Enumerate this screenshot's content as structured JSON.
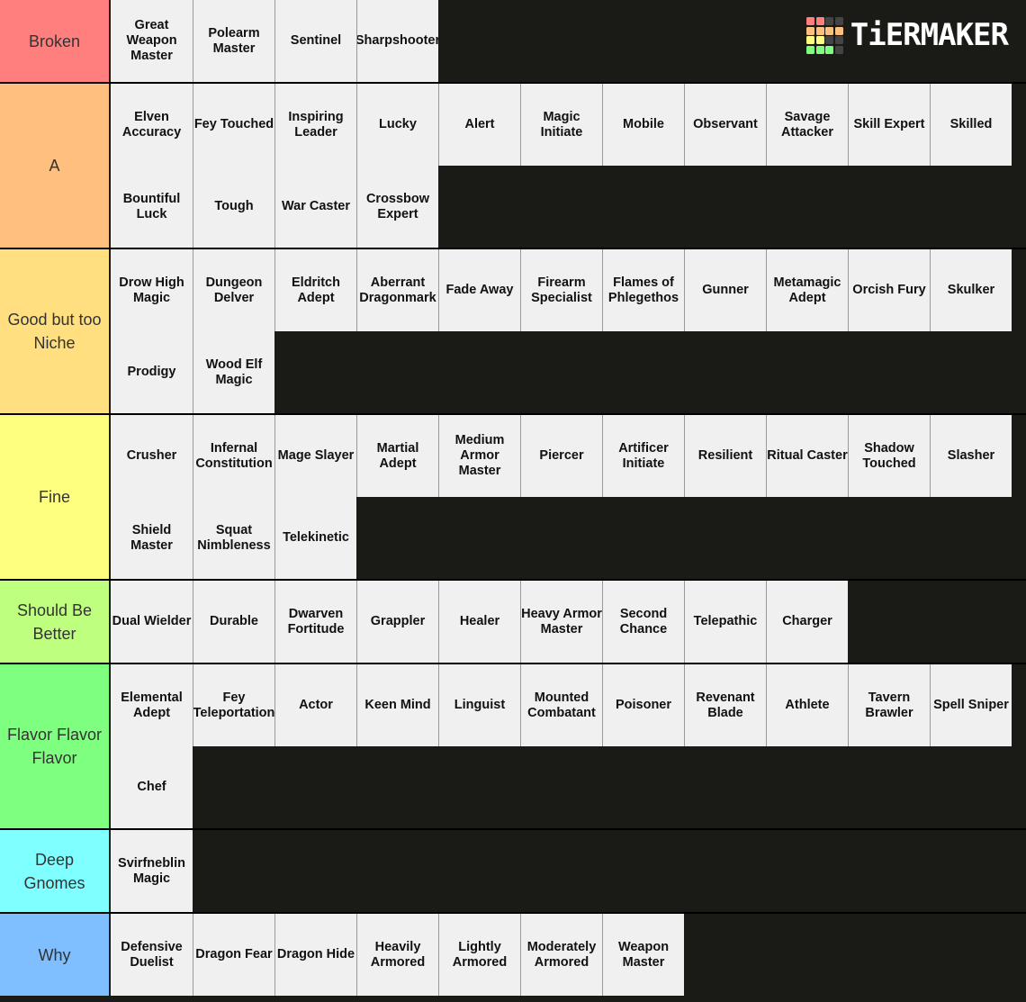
{
  "logo": {
    "text": "TiERMAKER",
    "grid_colors": [
      "#ff7f7f",
      "#ff7f7f",
      "#444444",
      "#444444",
      "#ffbf7f",
      "#ffbf7f",
      "#ffbf7f",
      "#ffbf7f",
      "#ffff7f",
      "#ffff7f",
      "#444444",
      "#444444",
      "#7fff7f",
      "#7fff7f",
      "#7fff7f",
      "#444444"
    ]
  },
  "tiers": [
    {
      "label": "Broken",
      "color": "#ff7f7f",
      "rows": [
        [
          "Great Weapon Master",
          "Polearm Master",
          "Sentinel",
          "Sharpshooter"
        ]
      ]
    },
    {
      "label": "A",
      "color": "#ffbf7f",
      "rows": [
        [
          "Elven Accuracy",
          "Fey Touched",
          "Inspiring Leader",
          "Lucky",
          "Alert",
          "Magic Initiate",
          "Mobile",
          "Observant",
          "Savage Attacker",
          "Skill Expert",
          "Skilled"
        ],
        [
          "Bountiful Luck",
          "Tough",
          "War Caster",
          "Crossbow Expert"
        ]
      ]
    },
    {
      "label": "Good but too Niche",
      "color": "#ffdf7f",
      "rows": [
        [
          "Drow High Magic",
          "Dungeon Delver",
          "Eldritch Adept",
          "Aberrant Dragonmark",
          "Fade Away",
          "Firearm Specialist",
          "Flames of Phlegethos",
          "Gunner",
          "Metamagic Adept",
          "Orcish Fury",
          "Skulker"
        ],
        [
          "Prodigy",
          "Wood Elf Magic"
        ]
      ]
    },
    {
      "label": "Fine",
      "color": "#ffff7f",
      "rows": [
        [
          "Crusher",
          "Infernal Constitution",
          "Mage Slayer",
          "Martial Adept",
          "Medium Armor Master",
          "Piercer",
          "Artificer Initiate",
          "Resilient",
          "Ritual Caster",
          "Shadow Touched",
          "Slasher"
        ],
        [
          "Shield Master",
          "Squat Nimbleness",
          "Telekinetic"
        ]
      ]
    },
    {
      "label": "Should Be Better",
      "color": "#bfff7f",
      "rows": [
        [
          "Dual Wielder",
          "Durable",
          "Dwarven Fortitude",
          "Grappler",
          "Healer",
          "Heavy Armor Master",
          "Second Chance",
          "Telepathic",
          "Charger"
        ]
      ]
    },
    {
      "label": "Flavor Flavor Flavor",
      "color": "#7fff7f",
      "rows": [
        [
          "Elemental Adept",
          "Fey Teleportation",
          "Actor",
          "Keen Mind",
          "Linguist",
          "Mounted Combatant",
          "Poisoner",
          "Revenant Blade",
          "Athlete",
          "Tavern Brawler",
          "Spell Sniper"
        ],
        [
          "Chef"
        ]
      ]
    },
    {
      "label": "Deep Gnomes",
      "color": "#7fffff",
      "rows": [
        [
          "Svirfneblin Magic"
        ]
      ]
    },
    {
      "label": "Why",
      "color": "#7fbfff",
      "rows": [
        [
          "Defensive Duelist",
          "Dragon Fear",
          "Dragon Hide",
          "Heavily Armored",
          "Lightly Armored",
          "Moderately Armored",
          "Weapon Master"
        ]
      ]
    }
  ]
}
